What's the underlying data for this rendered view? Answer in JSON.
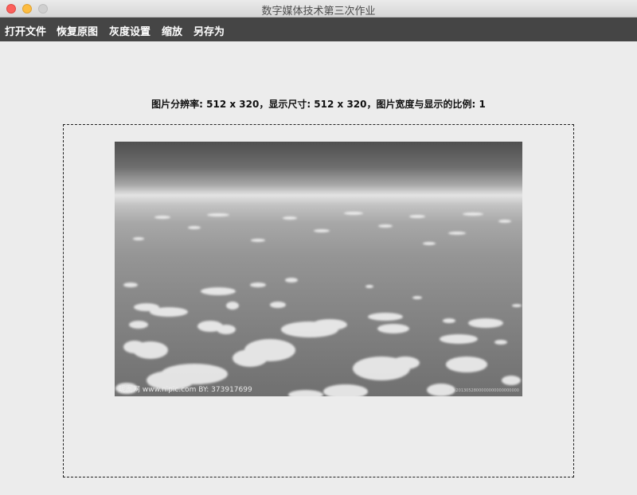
{
  "window": {
    "title": "数字媒体技术第三次作业"
  },
  "menu": {
    "items": [
      {
        "label": "打开文件"
      },
      {
        "label": "恢复原图"
      },
      {
        "label": "灰度设置"
      },
      {
        "label": "缩放"
      },
      {
        "label": "另存为"
      }
    ]
  },
  "info": {
    "text": "图片分辨率: 512 x 320，显示尺寸: 512 x 320，图片宽度与显示的比例: 1"
  },
  "image": {
    "subject": "grayscale aerial photo of clouds above the sea",
    "watermark_left": "昵图网 www.nipic.com  BY: 373917699",
    "watermark_right": "No.2013052800000000000000000"
  },
  "colors": {
    "titlebar": "#e0e0e0",
    "menubar": "#454545",
    "menu_text": "#ffffff",
    "window_bg": "#ececec",
    "close": "#fc605c",
    "minimize": "#fdbc40",
    "zoom": "#cfcfcf"
  },
  "icons": [
    "close-icon",
    "minimize-icon",
    "zoom-icon"
  ]
}
